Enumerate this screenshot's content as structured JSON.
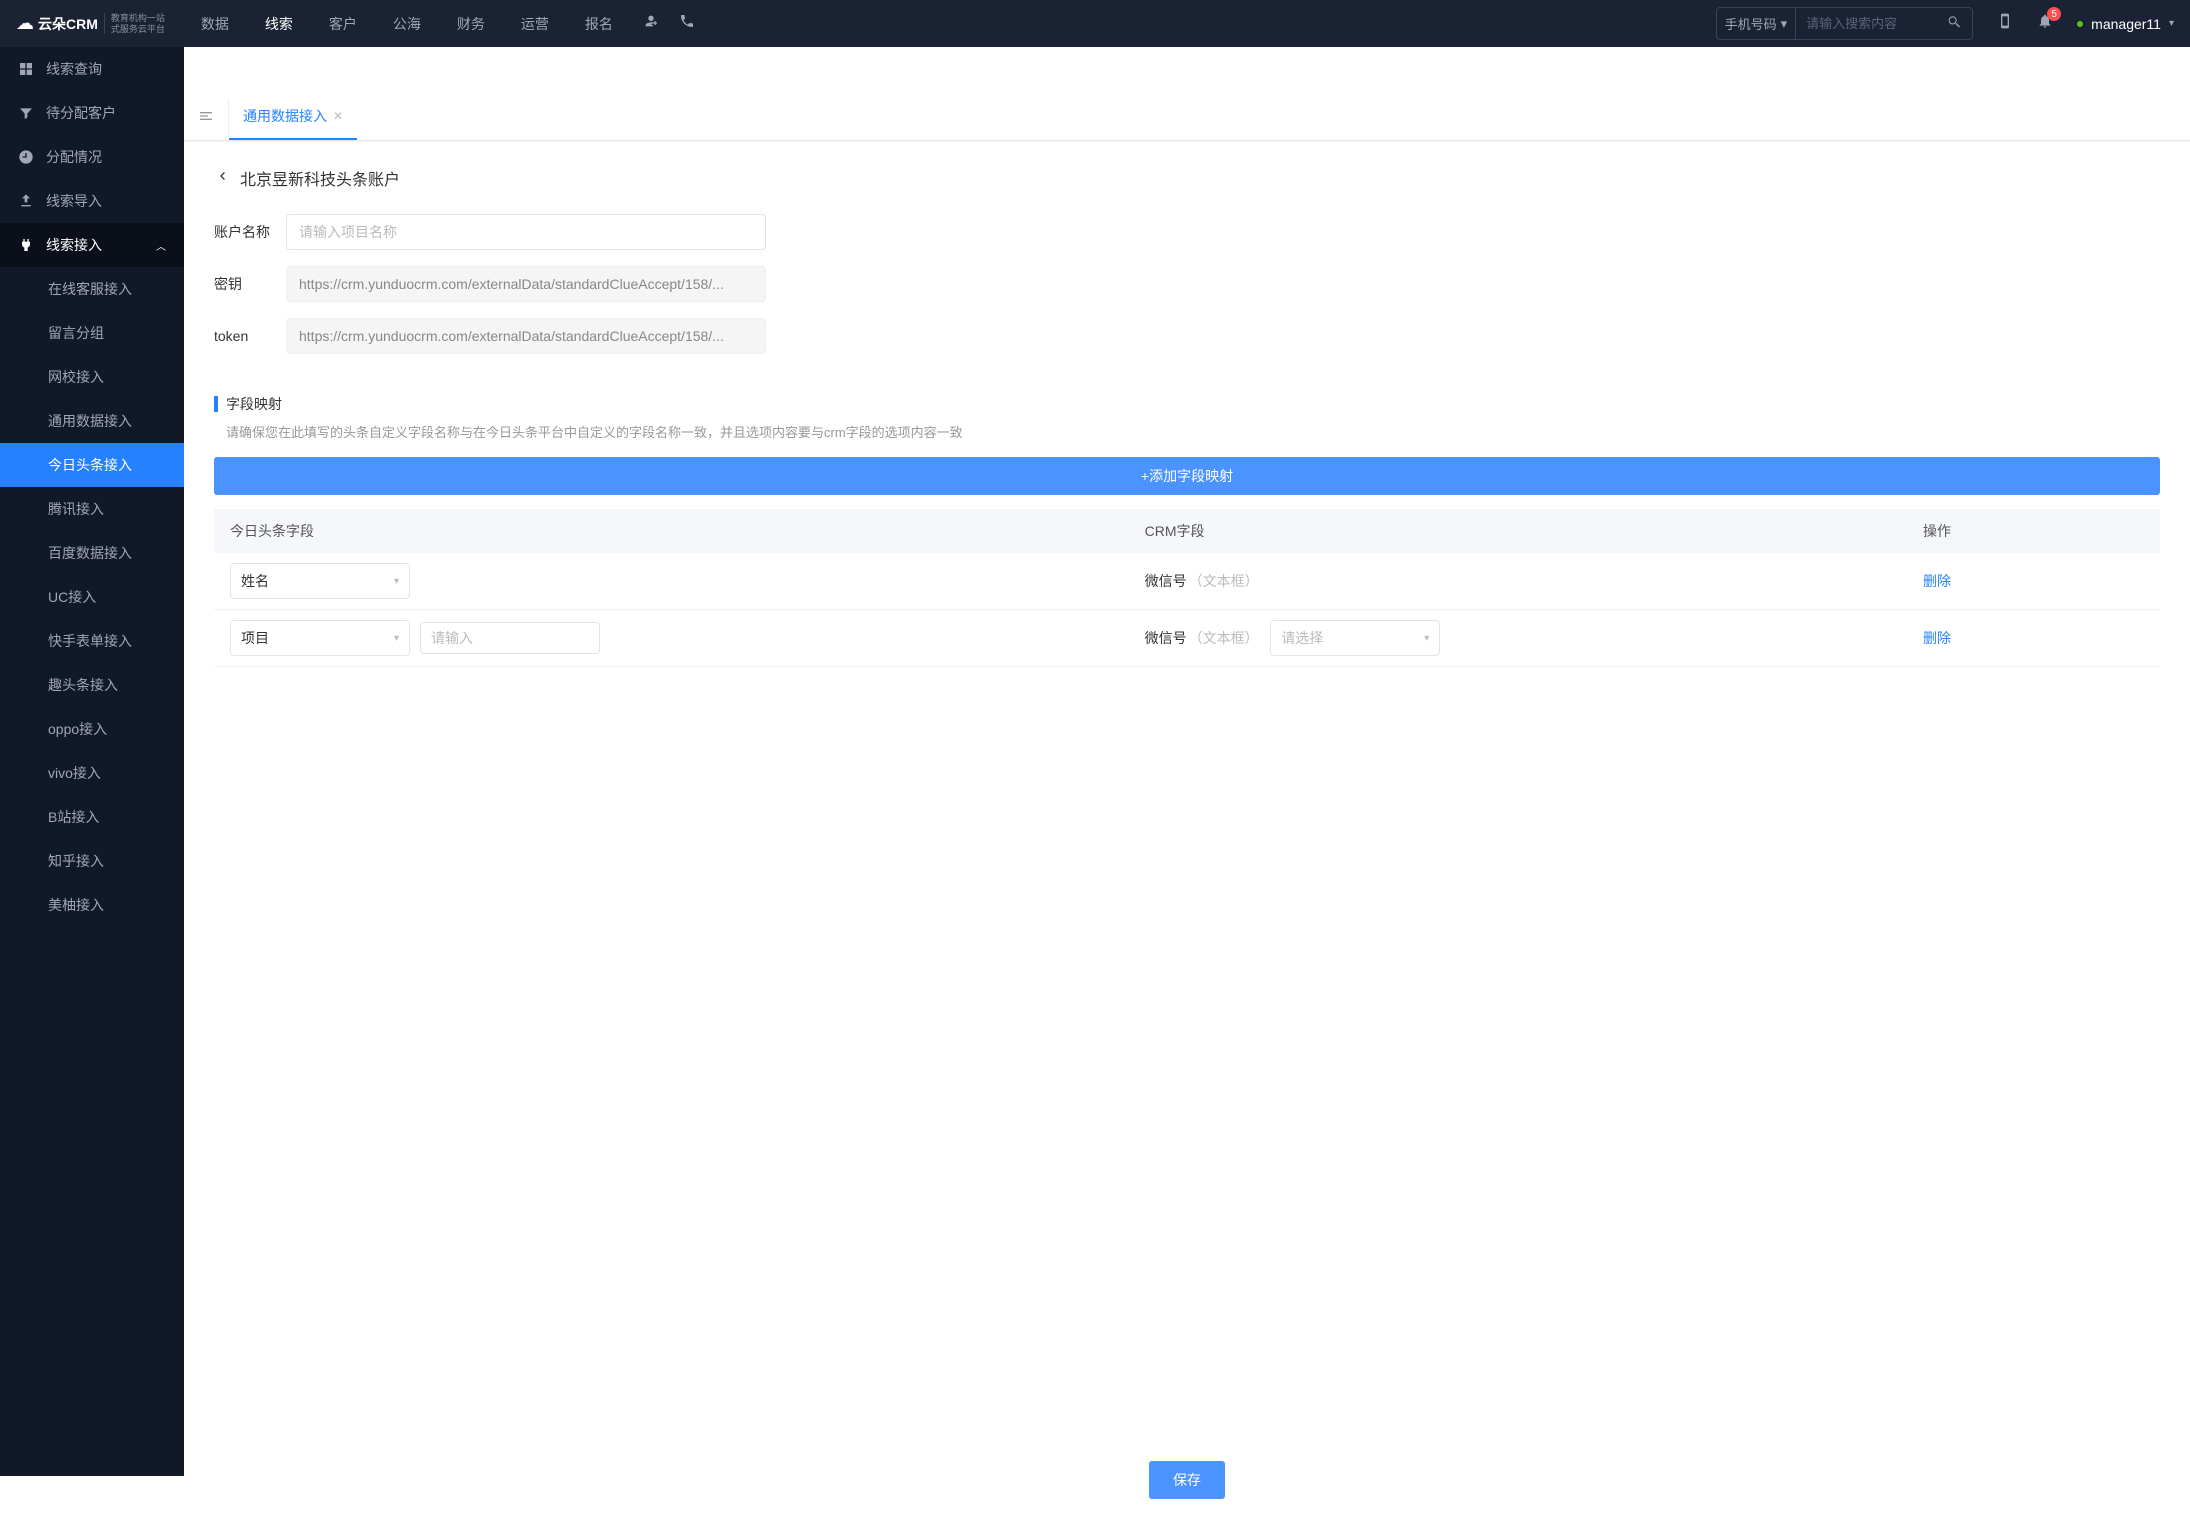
{
  "header": {
    "logo_text": "云朵CRM",
    "logo_sub_line1": "教育机构一站",
    "logo_sub_line2": "式服务云平台",
    "nav": [
      "数据",
      "线索",
      "客户",
      "公海",
      "财务",
      "运营",
      "报名"
    ],
    "nav_active_index": 1,
    "search_select": "手机号码",
    "search_placeholder": "请输入搜索内容",
    "badge_count": "5",
    "user_name": "manager11"
  },
  "sidebar": {
    "items": [
      {
        "icon": "grid",
        "label": "线索查询"
      },
      {
        "icon": "filter",
        "label": "待分配客户"
      },
      {
        "icon": "clock",
        "label": "分配情况"
      },
      {
        "icon": "upload",
        "label": "线索导入"
      },
      {
        "icon": "plug",
        "label": "线索接入",
        "expanded": true
      }
    ],
    "sub_items": [
      "在线客服接入",
      "留言分组",
      "网校接入",
      "通用数据接入",
      "今日头条接入",
      "腾讯接入",
      "百度数据接入",
      "UC接入",
      "快手表单接入",
      "趣头条接入",
      "oppo接入",
      "vivo接入",
      "B站接入",
      "知乎接入",
      "美柚接入"
    ],
    "sub_active_index": 4
  },
  "tabs": {
    "items": [
      "通用数据接入"
    ],
    "active_index": 0
  },
  "page": {
    "title": "北京昱新科技头条账户",
    "form": {
      "account_label": "账户名称",
      "account_placeholder": "请输入项目名称",
      "secret_label": "密钥",
      "secret_value": "https://crm.yunduocrm.com/externalData/standardClueAccept/158/...",
      "token_label": "token",
      "token_value": "https://crm.yunduocrm.com/externalData/standardClueAccept/158/..."
    },
    "mapping": {
      "title": "字段映射",
      "desc": "请确保您在此填写的头条自定义字段名称与在今日头条平台中自定义的字段名称一致，并且选项内容要与crm字段的选项内容一致",
      "add_btn": "+添加字段映射",
      "cols": [
        "今日头条字段",
        "CRM字段",
        "操作"
      ],
      "rows": [
        {
          "tt_field": "姓名",
          "tt_extra_input": false,
          "crm_label": "微信号",
          "crm_hint": "（文本框）",
          "crm_select": false,
          "crm_select_ph": "",
          "delete": "删除"
        },
        {
          "tt_field": "项目",
          "tt_extra_input": true,
          "tt_extra_ph": "请输入",
          "crm_label": "微信号",
          "crm_hint": "（文本框）",
          "crm_select": true,
          "crm_select_ph": "请选择",
          "delete": "删除"
        }
      ]
    },
    "save_btn": "保存"
  }
}
